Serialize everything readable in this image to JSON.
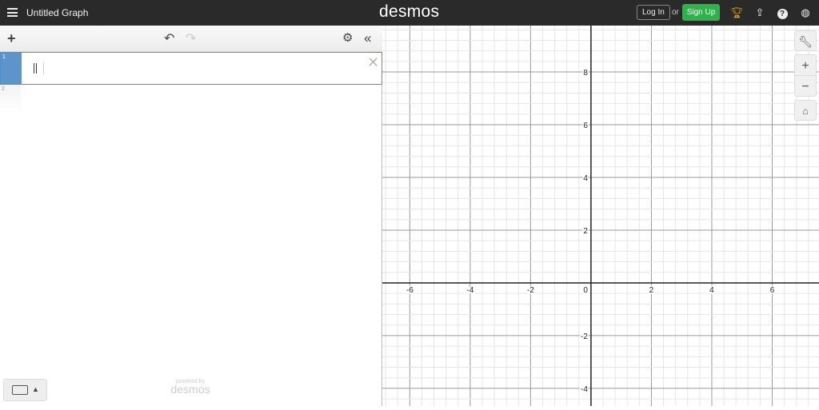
{
  "header": {
    "title": "Untitled Graph",
    "logo": "desmos",
    "login": "Log In",
    "or": "or",
    "signup": "Sign Up",
    "icons": [
      "trophy-icon",
      "share-icon",
      "help-icon",
      "globe-icon"
    ]
  },
  "panel": {
    "expressions": [
      {
        "index": "1",
        "value": ""
      },
      {
        "index": "2",
        "value": ""
      }
    ],
    "powered_by": "powered by",
    "powered_logo": "desmos"
  },
  "graph": {
    "xmin": -6.91,
    "xmax": 7.55,
    "ymin": -4.67,
    "ymax": 9.76,
    "major_step": 2,
    "minor_per_major": 5,
    "x_ticks": [
      "-6",
      "-4",
      "-2",
      "2",
      "4",
      "6"
    ],
    "y_ticks": [
      "-4",
      "-2",
      "2",
      "4",
      "6",
      "8"
    ],
    "origin_label": "0"
  },
  "colors": {
    "header": "#2a2a2a",
    "signup": "#2fb24c",
    "expression_active": "#5d94c9",
    "trophy": "#e8a317"
  }
}
